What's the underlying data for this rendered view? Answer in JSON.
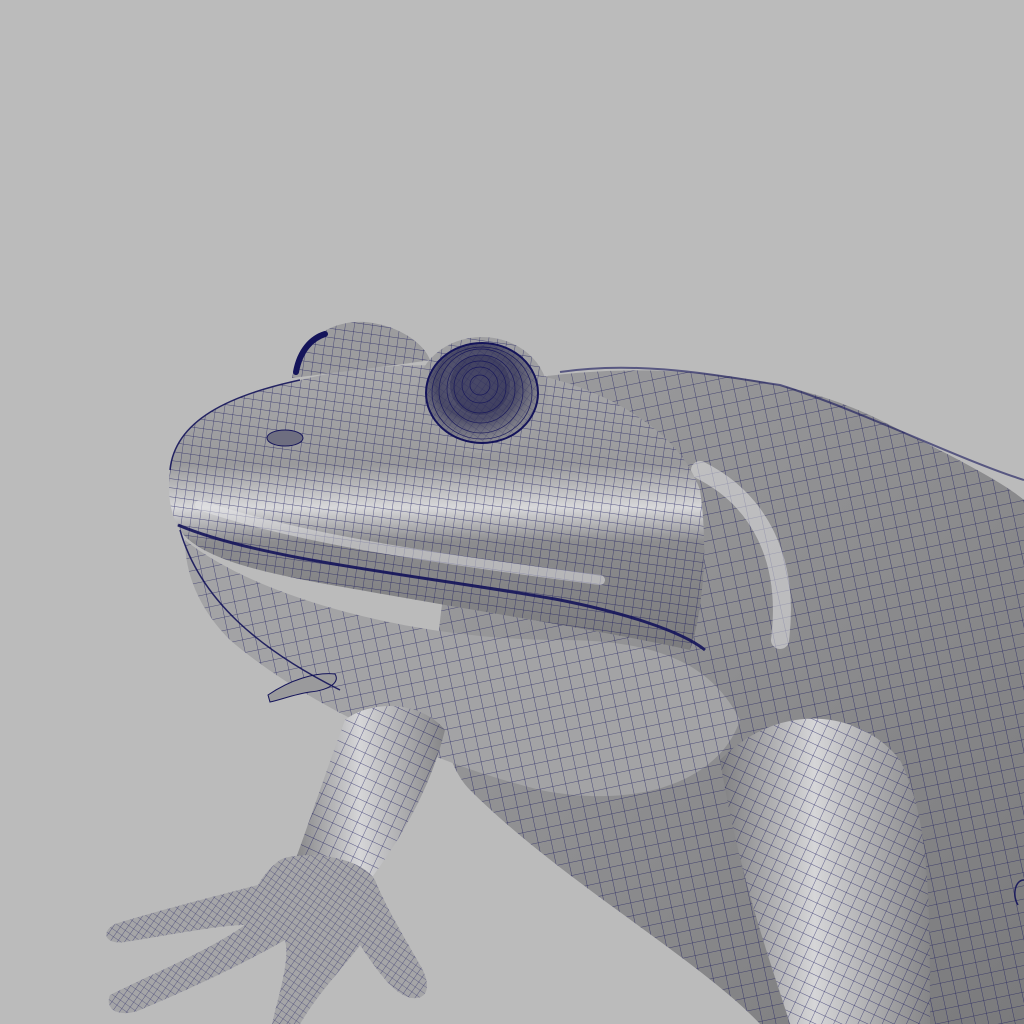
{
  "viewport": {
    "background_color": "#bbbbbb",
    "subject": "frog-wireframe-model",
    "wire_color": "#14145a",
    "surface_color": "#8f8f91",
    "highlight_color": "#d9d9da"
  }
}
